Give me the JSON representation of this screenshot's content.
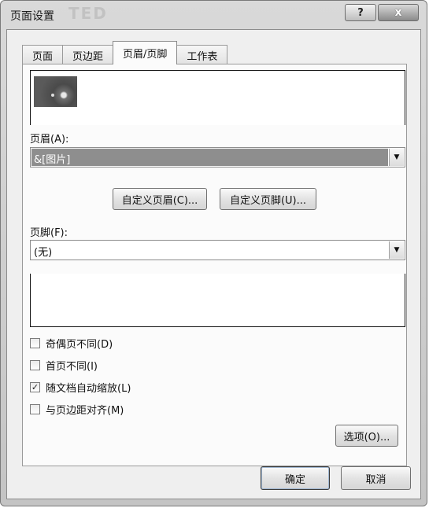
{
  "window": {
    "title": "页面设置",
    "title_ghost": "TED",
    "help_glyph": "?",
    "close_glyph": "x"
  },
  "tabs": [
    {
      "label": "页面"
    },
    {
      "label": "页边距"
    },
    {
      "label": "页眉/页脚",
      "active": true
    },
    {
      "label": "工作表"
    }
  ],
  "header": {
    "label": "页眉(A):",
    "value": "&[图片]",
    "custom_button": "自定义页眉(C)...",
    "custom_footer_button": "自定义页脚(U)..."
  },
  "footer": {
    "label": "页脚(F):",
    "value": "(无)"
  },
  "checkboxes": [
    {
      "label": "奇偶页不同(D)",
      "checked": false
    },
    {
      "label": "首页不同(I)",
      "checked": false
    },
    {
      "label": "随文档自动缩放(L)",
      "checked": true
    },
    {
      "label": "与页边距对齐(M)",
      "checked": false
    }
  ],
  "buttons": {
    "options": "选项(O)...",
    "ok": "确定",
    "cancel": "取消"
  },
  "icons": {
    "dropdown": "chevron-down-icon",
    "check": "checkmark-icon"
  }
}
